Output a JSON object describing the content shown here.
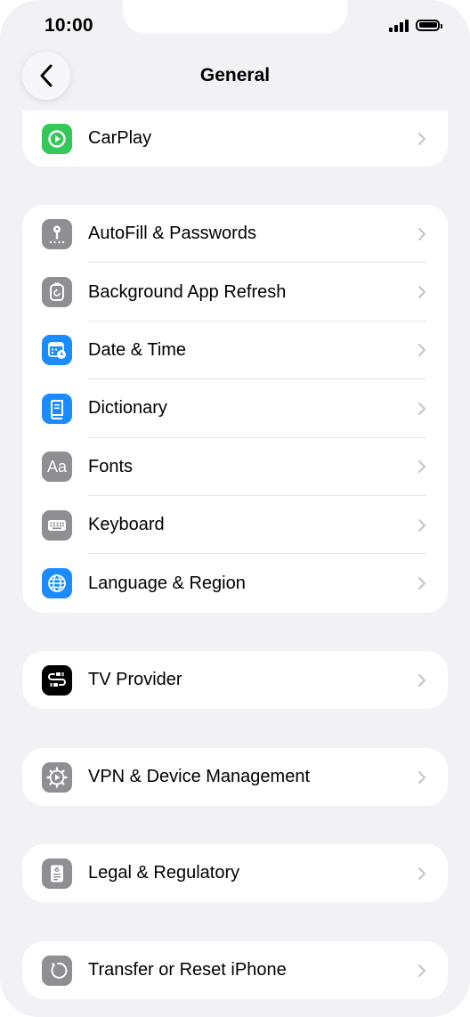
{
  "status_bar": {
    "time": "10:00"
  },
  "header": {
    "title": "General"
  },
  "groups": [
    {
      "rows": [
        {
          "label": "CarPlay",
          "icon": "carplay-icon",
          "color": "#34c759"
        }
      ]
    },
    {
      "rows": [
        {
          "label": "AutoFill & Passwords",
          "icon": "key-icon",
          "color": "#8e8e93"
        },
        {
          "label": "Background App Refresh",
          "icon": "refresh-icon",
          "color": "#8e8e93"
        },
        {
          "label": "Date & Time",
          "icon": "calendar-clock-icon",
          "color": "#1a8cff"
        },
        {
          "label": "Dictionary",
          "icon": "book-icon",
          "color": "#1a8cff"
        },
        {
          "label": "Fonts",
          "icon": "fonts-icon",
          "color": "#8e8e93"
        },
        {
          "label": "Keyboard",
          "icon": "keyboard-icon",
          "color": "#8e8e93"
        },
        {
          "label": "Language & Region",
          "icon": "globe-icon",
          "color": "#1a8cff"
        }
      ]
    },
    {
      "rows": [
        {
          "label": "TV Provider",
          "icon": "tv-provider-icon",
          "color": "#000000"
        }
      ]
    },
    {
      "rows": [
        {
          "label": "VPN & Device Management",
          "icon": "gear-icon",
          "color": "#8e8e93"
        }
      ]
    },
    {
      "rows": [
        {
          "label": "Legal & Regulatory",
          "icon": "legal-icon",
          "color": "#8e8e93"
        }
      ]
    },
    {
      "rows": [
        {
          "label": "Transfer or Reset iPhone",
          "icon": "reset-icon",
          "color": "#8e8e93"
        }
      ]
    }
  ]
}
